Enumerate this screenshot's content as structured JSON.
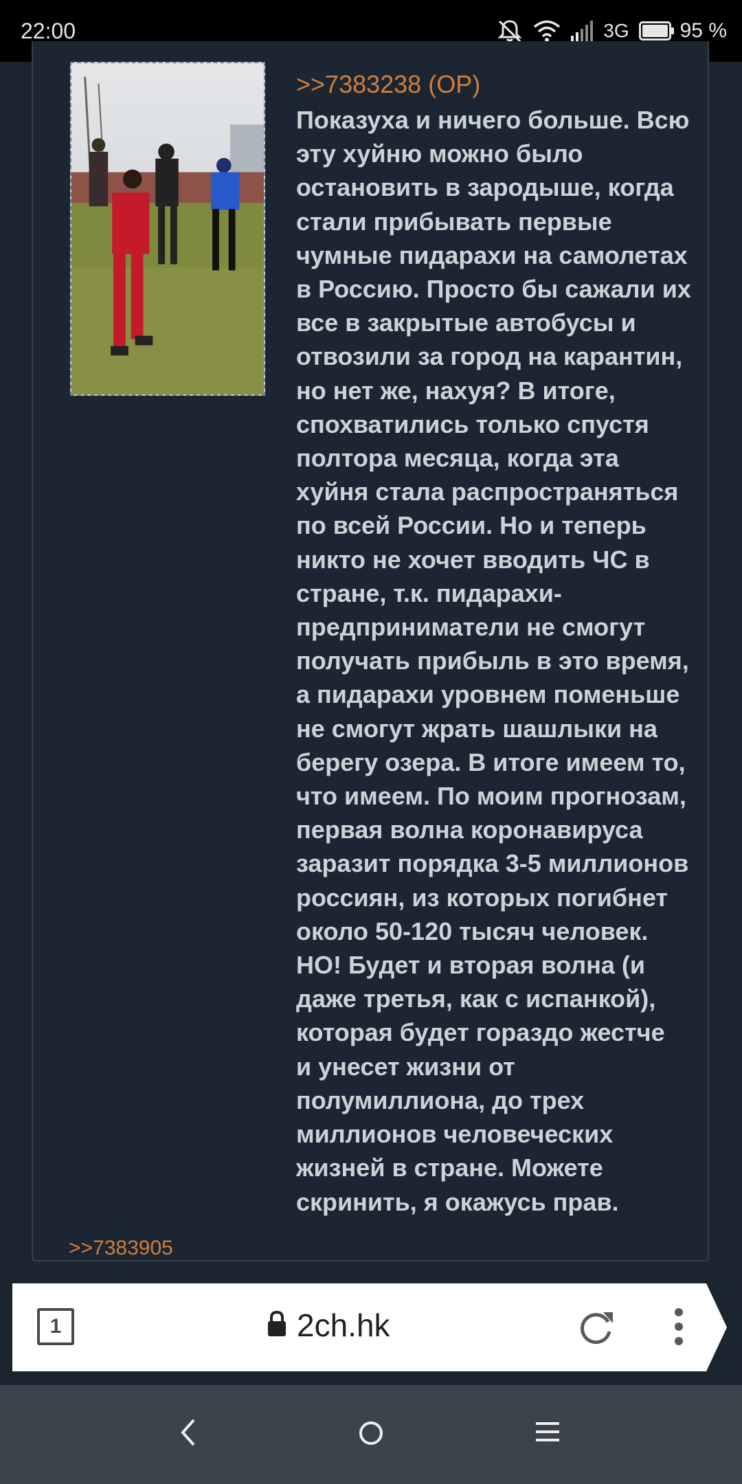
{
  "status_bar": {
    "time": "22:00",
    "network": "3G",
    "battery": "95 %"
  },
  "post": {
    "ref": ">>7383238 (OP)",
    "body_lines": [
      "Показуха и ничего больше. Всю",
      "эту хуйню можно было",
      "остановить в зародыше, когда",
      "стали прибывать первые",
      "чумные пидарахи на самолетах",
      "в Россию. Просто бы сажали их",
      "все в закрытые автобусы и",
      "отвозили за город на карантин,",
      "но нет же, нахуя? В итоге,",
      "спохватились только спустя",
      "полтора месяца, когда эта",
      "хуйня стала распространяться",
      "по всей России. Но и теперь",
      "никто не хочет вводить ЧС в",
      "стране, т.к. пидарахи-",
      "предприниматели не смогут",
      "получать прибыль в это время,",
      "а пидарахи уровнем поменьше",
      "не смогут жрать шашлыки на",
      "берегу озера. В итоге имеем то,",
      "что имеем. По моим прогнозам,",
      "первая волна коронавируса",
      "заразит порядка 3-5 миллионов",
      "россиян, из которых погибнет",
      "около 50-120 тысяч человек.",
      "НО! Будет и вторая волна (и",
      "даже третья, как с испанкой),",
      "которая будет гораздо жестче",
      "и унесет жизни от",
      "полумиллиона, до трех",
      "миллионов человеческих",
      "жизней в стране. Можете",
      "скринить, я окажусь прав."
    ],
    "reply_link": ">>7383905"
  },
  "browser": {
    "tab_count": "1",
    "url": "2ch.hk"
  },
  "colors": {
    "background": "#1b2530",
    "link": "#d27d3c",
    "text": "#cdd2d6"
  },
  "icons": [
    "mute-icon",
    "wifi-icon",
    "signal-icon",
    "battery-icon",
    "lock-icon",
    "reload-icon",
    "more-vert-icon",
    "back-icon",
    "home-icon",
    "recents-icon"
  ]
}
